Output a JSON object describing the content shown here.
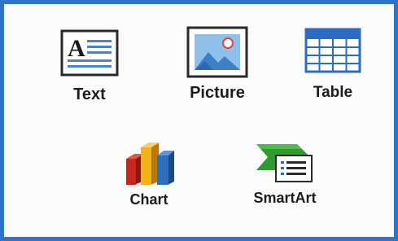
{
  "panel": {
    "items": [
      {
        "id": "text",
        "label": "Text",
        "icon": "text-box-icon"
      },
      {
        "id": "picture",
        "label": "Picture",
        "icon": "picture-icon"
      },
      {
        "id": "table",
        "label": "Table",
        "icon": "table-icon"
      },
      {
        "id": "chart",
        "label": "Chart",
        "icon": "bar-chart-icon"
      },
      {
        "id": "smartart",
        "label": "SmartArt",
        "icon": "smartart-icon"
      }
    ],
    "text_icon_glyph": "A"
  },
  "colors": {
    "frame_border": "#2f73c9",
    "icon_blue": "#4a83c8",
    "table_header": "#2d6cc0",
    "chart_red": "#c8261c",
    "chart_yellow": "#f2b21a",
    "chart_blue": "#2c6fbf",
    "smartart_green": "#2f9a2f"
  }
}
